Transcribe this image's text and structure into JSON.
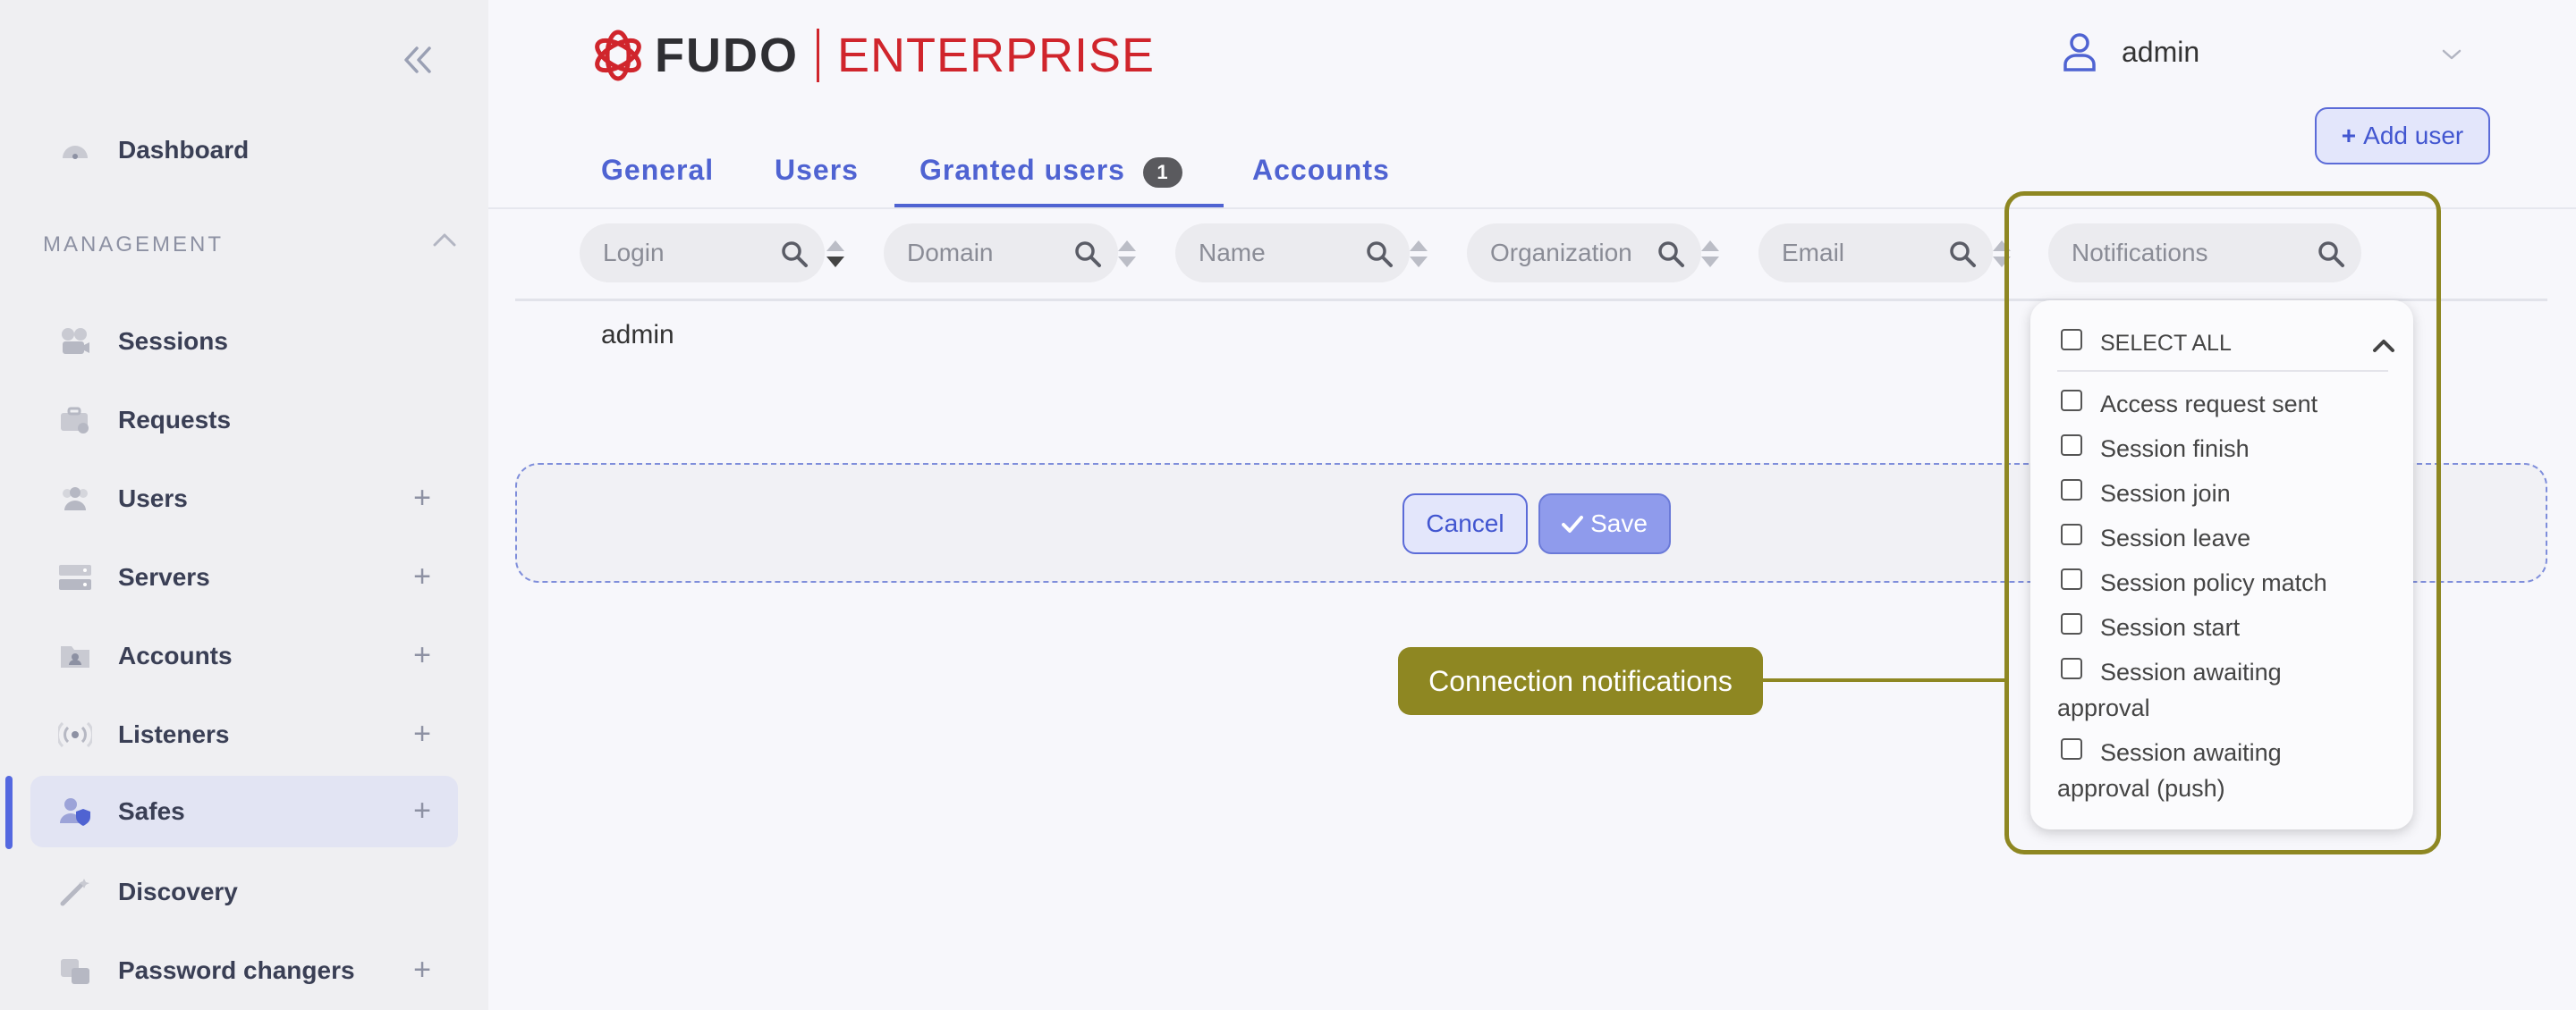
{
  "sidebar": {
    "section": "MANAGEMENT",
    "items": [
      {
        "label": "Dashboard",
        "icon": "dashboard-icon"
      },
      {
        "label": "Sessions",
        "icon": "sessions-icon"
      },
      {
        "label": "Requests",
        "icon": "requests-icon"
      },
      {
        "label": "Users",
        "icon": "users-icon",
        "plus": "+"
      },
      {
        "label": "Servers",
        "icon": "servers-icon",
        "plus": "+"
      },
      {
        "label": "Accounts",
        "icon": "accounts-icon",
        "plus": "+"
      },
      {
        "label": "Listeners",
        "icon": "listeners-icon",
        "plus": "+"
      },
      {
        "label": "Safes",
        "icon": "safes-icon",
        "plus": "+",
        "active": true
      },
      {
        "label": "Discovery",
        "icon": "discovery-icon"
      },
      {
        "label": "Password changers",
        "icon": "password-changers-icon",
        "plus": "+"
      }
    ]
  },
  "header": {
    "logo_main": "FUDO",
    "logo_sub": "ENTERPRISE",
    "user": "admin",
    "add_user": "Add user"
  },
  "tabs": [
    {
      "label": "General"
    },
    {
      "label": "Users"
    },
    {
      "label": "Granted users",
      "badge": "1",
      "active": true
    },
    {
      "label": "Accounts"
    }
  ],
  "filters": [
    {
      "placeholder": "Login"
    },
    {
      "placeholder": "Domain"
    },
    {
      "placeholder": "Name"
    },
    {
      "placeholder": "Organization"
    },
    {
      "placeholder": "Email"
    },
    {
      "placeholder": "Notifications"
    }
  ],
  "rows": [
    {
      "login": "admin"
    }
  ],
  "actions": {
    "cancel": "Cancel",
    "save": "Save"
  },
  "notifications_dropdown": {
    "select_all": "SELECT ALL",
    "options": [
      "Access request sent",
      "Session finish",
      "Session join",
      "Session leave",
      "Session policy match",
      "Session start",
      "Session awaiting approval",
      "Session awaiting approval (push)"
    ]
  },
  "callout": "Connection notifications",
  "colors": {
    "accent": "#4f63d2",
    "brand_red": "#d0252c",
    "callout": "#8e8722"
  }
}
